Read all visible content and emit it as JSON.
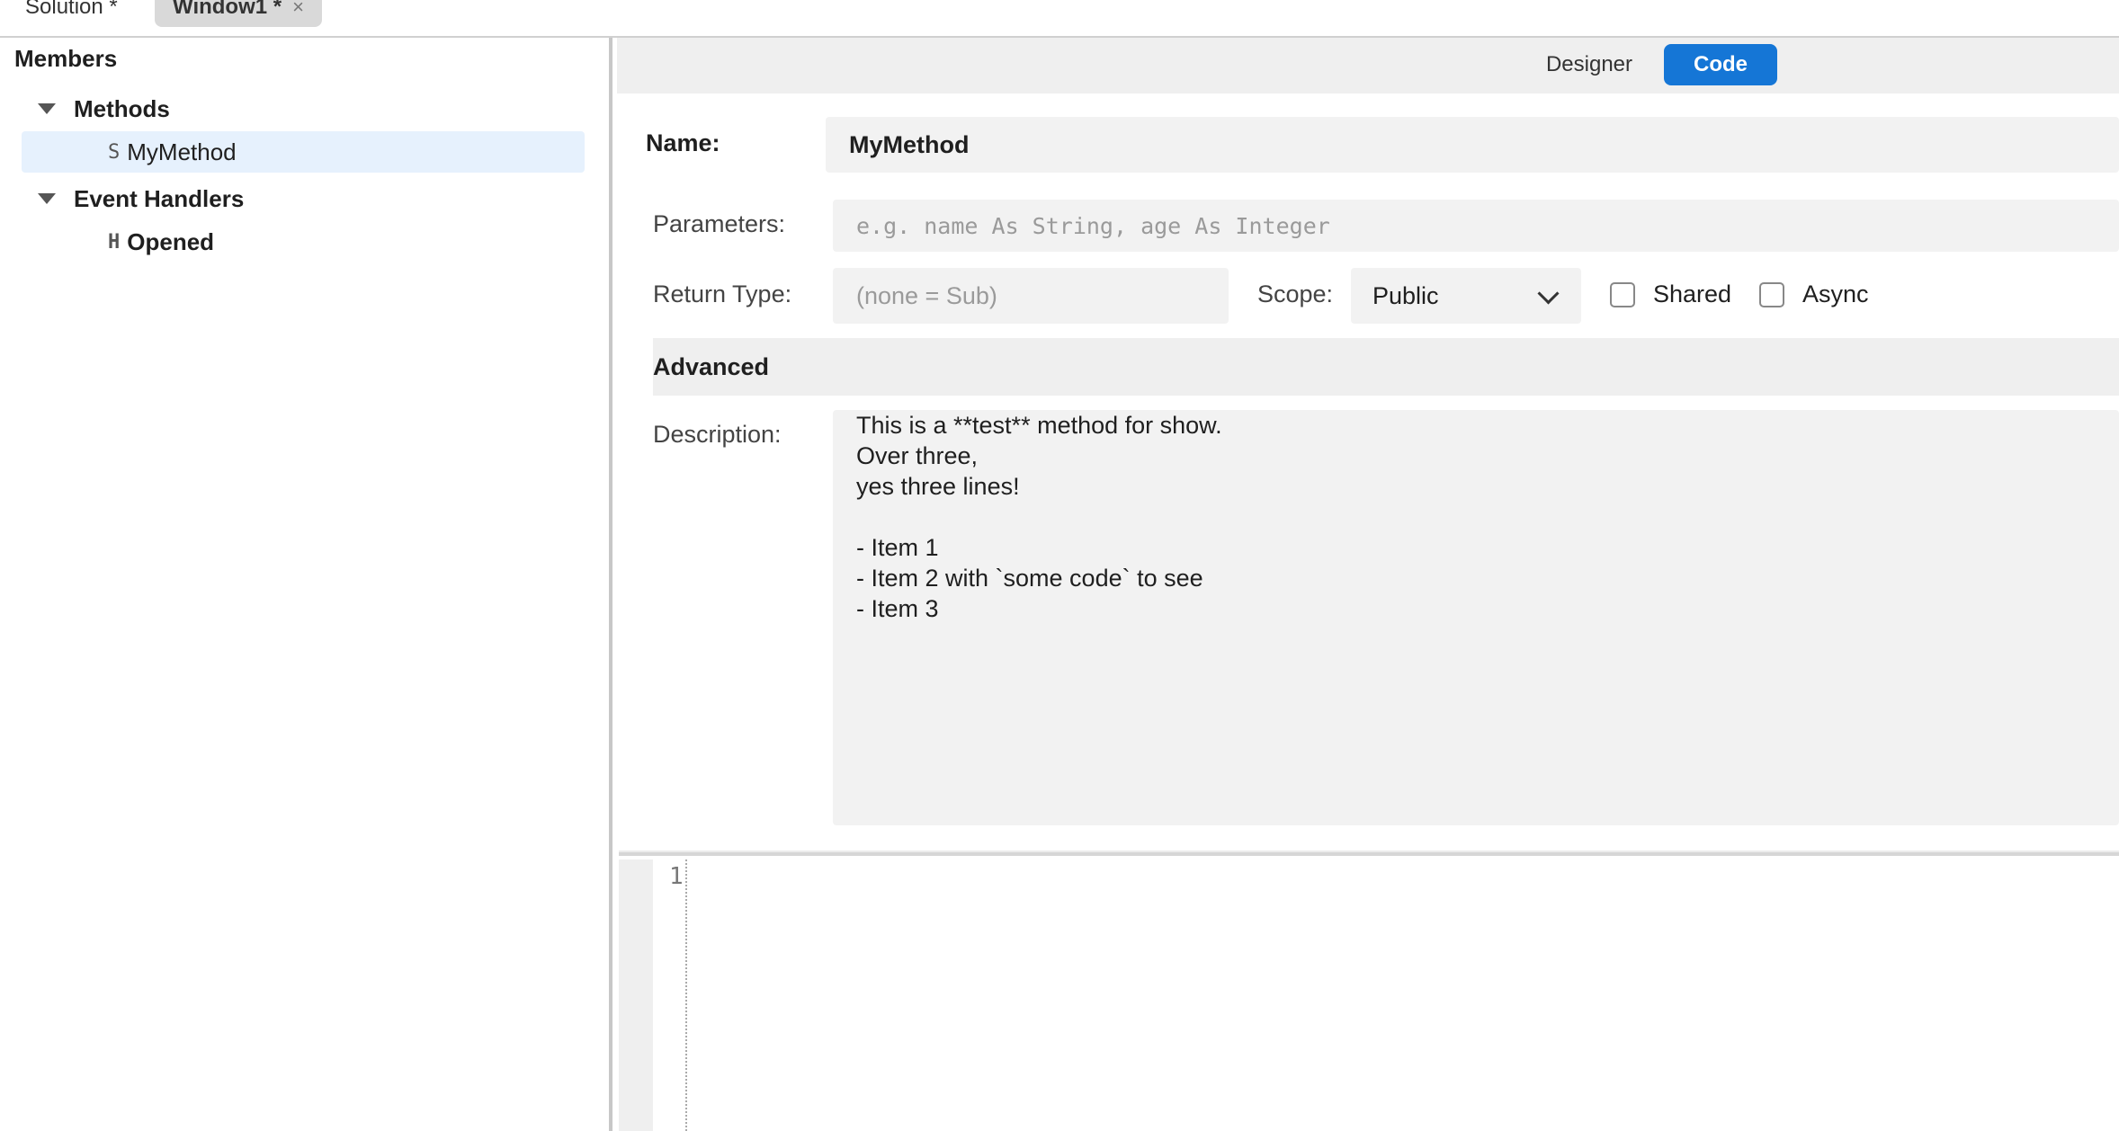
{
  "tabs": [
    {
      "label": "Solution *"
    },
    {
      "label": "Window1 *",
      "close": "×"
    }
  ],
  "members": {
    "title": "Members",
    "groups": [
      {
        "label": "Methods",
        "items": [
          {
            "kind": "S",
            "label": "MyMethod",
            "selected": true
          }
        ]
      },
      {
        "label": "Event Handlers",
        "items": [
          {
            "kind": "H",
            "label": "Opened",
            "selected": false
          }
        ]
      }
    ]
  },
  "view_toggle": {
    "designer": "Designer",
    "code": "Code",
    "active": "Code"
  },
  "form": {
    "name_label": "Name:",
    "name_value": "MyMethod",
    "params_label": "Parameters:",
    "params_placeholder": "e.g. name As String, age As Integer",
    "return_label": "Return Type:",
    "return_placeholder": "(none = Sub)",
    "scope_label": "Scope:",
    "scope_value": "Public",
    "shared_label": "Shared",
    "shared_checked": false,
    "async_label": "Async",
    "async_checked": false,
    "advanced_label": "Advanced",
    "description_label": "Description:",
    "description_lines": [
      "This is a **test** method for show.",
      "Over three,",
      "yes three lines!",
      "",
      "- Item 1",
      "- Item 2 with `some code` to see",
      "- Item 3"
    ]
  },
  "editor": {
    "line_numbers": [
      "1"
    ]
  },
  "colors": {
    "accent": "#1576d6",
    "selected_row": "#e6f1fd",
    "field_bg": "#f2f2f2"
  }
}
